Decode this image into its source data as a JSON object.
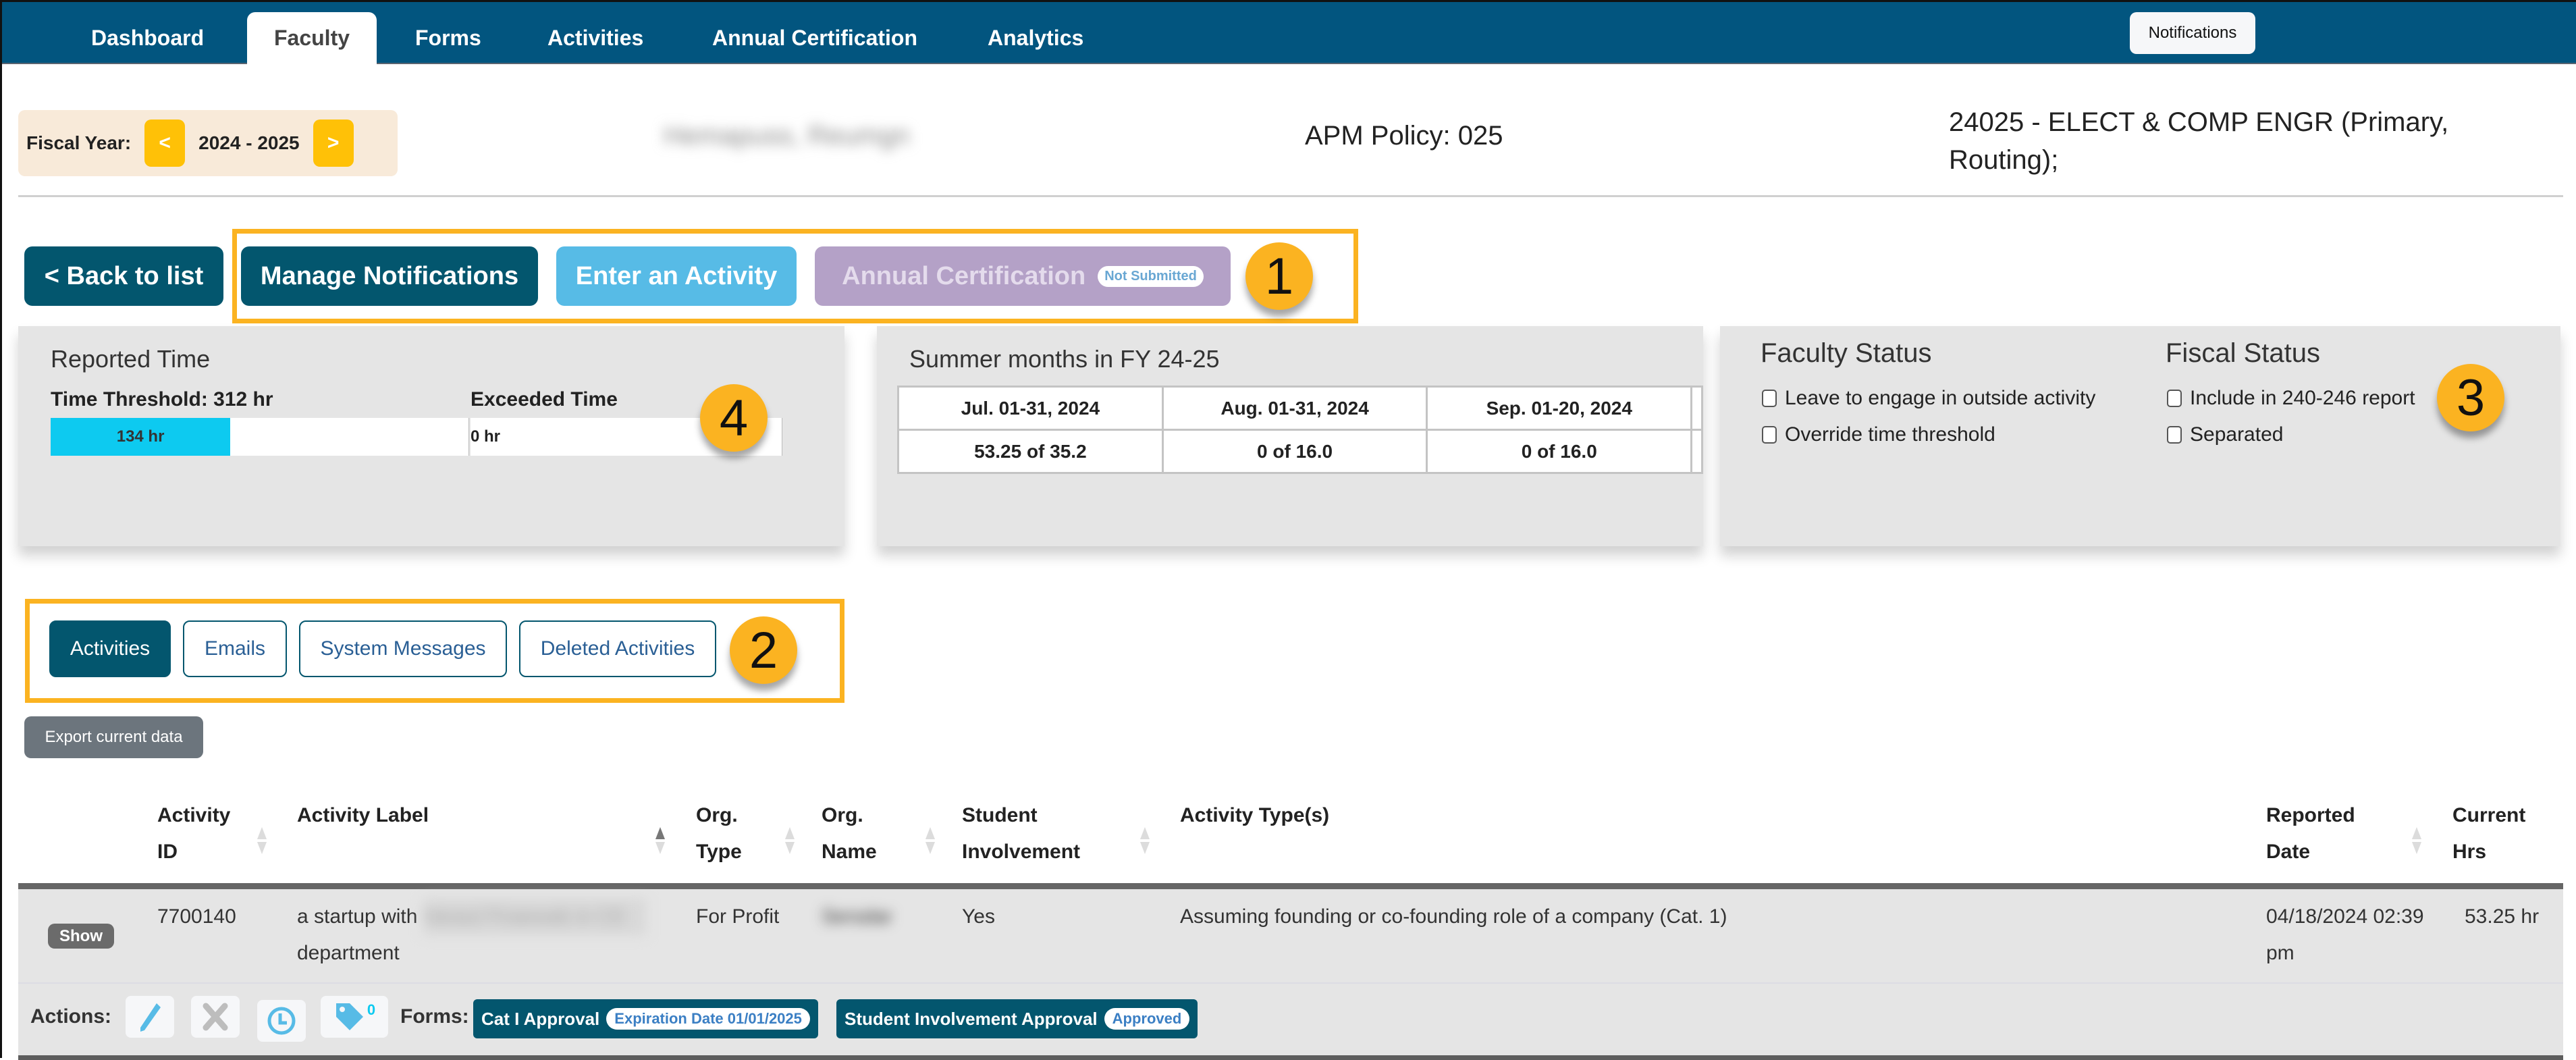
{
  "nav": {
    "tabs": [
      {
        "label": "Dashboard",
        "active": false
      },
      {
        "label": "Faculty",
        "active": true
      },
      {
        "label": "Forms",
        "active": false
      },
      {
        "label": "Activities",
        "active": false
      },
      {
        "label": "Annual Certification",
        "active": false
      },
      {
        "label": "Analytics",
        "active": false
      }
    ],
    "notifications_label": "Notifications"
  },
  "header": {
    "fiscal_year_label": "Fiscal Year:",
    "fiscal_year_value": "2024 - 2025",
    "prev_label": "<",
    "next_label": ">",
    "faculty_name": "Hemapuss, Reumgn",
    "apm_policy": "APM Policy: 025",
    "department": "24025 - ELECT & COMP ENGR (Primary, Routing);"
  },
  "actions": {
    "back_label": "< Back to list",
    "manage_notifications_label": "Manage Notifications",
    "enter_activity_label": "Enter an Activity",
    "annual_certification_label": "Annual Certification",
    "annual_certification_status": "Not Submitted"
  },
  "callouts": [
    "1",
    "2",
    "3",
    "4"
  ],
  "reported_time": {
    "title": "Reported Time",
    "threshold_label": "Time Threshold: 312 hr",
    "threshold_hours": 312,
    "reported_hours": 134,
    "reported_label": "134 hr",
    "reported_fraction": 0.43,
    "exceeded_label": "Exceeded Time",
    "exceeded_value": "0 hr"
  },
  "summer": {
    "title": "Summer months in FY 24-25",
    "months": [
      {
        "period": "Jul. 01-31, 2024",
        "value": "53.25 of 35.2"
      },
      {
        "period": "Aug. 01-31, 2024",
        "value": "0 of 16.0"
      },
      {
        "period": "Sep. 01-20, 2024",
        "value": "0 of 16.0"
      }
    ]
  },
  "faculty_status": {
    "title": "Faculty Status",
    "options": [
      {
        "label": "Leave to engage in outside activity",
        "checked": false
      },
      {
        "label": "Override time threshold",
        "checked": false
      }
    ]
  },
  "fiscal_status": {
    "title": "Fiscal Status",
    "options": [
      {
        "label": "Include in 240-246 report",
        "checked": false
      },
      {
        "label": "Separated",
        "checked": false
      }
    ]
  },
  "subtabs": [
    {
      "label": "Activities",
      "active": true
    },
    {
      "label": "Emails",
      "active": false
    },
    {
      "label": "System Messages",
      "active": false
    },
    {
      "label": "Deleted Activities",
      "active": false
    }
  ],
  "export_label": "Export current data",
  "table": {
    "columns": [
      {
        "line1": "Activity",
        "line2": "ID"
      },
      {
        "line1": "",
        "line2": "Activity Label"
      },
      {
        "line1": "Org.",
        "line2": "Type"
      },
      {
        "line1": "Org.",
        "line2": "Name"
      },
      {
        "line1": "Student",
        "line2": "Involvement"
      },
      {
        "line1": "",
        "line2": "Activity Type(s)"
      },
      {
        "line1": "Reported",
        "line2": "Date"
      },
      {
        "line1": "Current",
        "line2": "Hrs"
      }
    ],
    "rows": [
      {
        "show_label": "Show",
        "activity_id": "7700140",
        "label_line1": "a startup with",
        "label_redacted": "Varaut Firaewab in CE",
        "label_line2": "department",
        "org_type": "For Profit",
        "org_name": "Sersdar",
        "student_involvement": "Yes",
        "activity_types": "Assuming founding or co-founding role of a company (Cat. 1)",
        "reported_date_line1": "04/18/2024 02:39",
        "reported_date_line2": "pm",
        "current_hrs": "53.25 hr",
        "actions_label": "Actions:",
        "tag_count": "0",
        "forms_label": "Forms:",
        "forms": [
          {
            "label": "Cat I Approval",
            "status": "Expiration Date 01/01/2025"
          },
          {
            "label": "Student Involvement Approval",
            "status": "Approved"
          }
        ]
      }
    ]
  },
  "colors": {
    "nav": "#02557f",
    "primary_dark": "#03566e",
    "info": "#57bbe6",
    "warning": "#ffc107",
    "callout": "#fbb321",
    "progress": "#0dcaf0"
  }
}
